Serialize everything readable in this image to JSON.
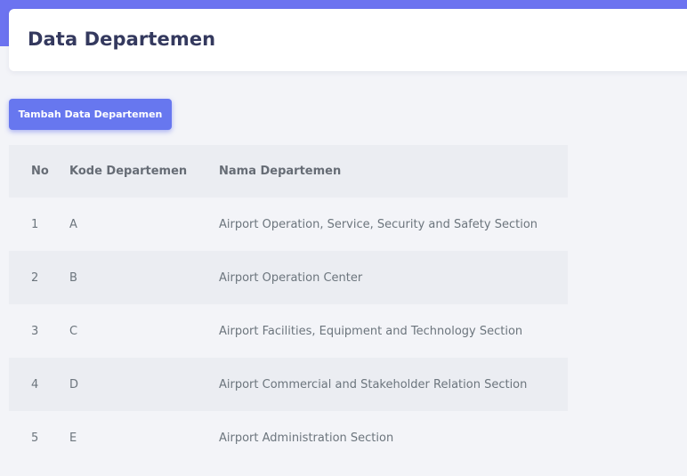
{
  "header": {
    "title": "Data Departemen"
  },
  "toolbar": {
    "add_label": "Tambah Data Departemen"
  },
  "table": {
    "columns": [
      "No",
      "Kode Departemen",
      "Nama Departemen"
    ],
    "rows": [
      {
        "no": "1",
        "kode": "A",
        "nama": "Airport Operation, Service, Security and Safety Section"
      },
      {
        "no": "2",
        "kode": "B",
        "nama": "Airport Operation Center"
      },
      {
        "no": "3",
        "kode": "C",
        "nama": "Airport Facilities, Equipment and Technology Section"
      },
      {
        "no": "4",
        "kode": "D",
        "nama": "Airport Commercial and Stakeholder Relation Section"
      },
      {
        "no": "5",
        "kode": "E",
        "nama": "Airport Administration Section"
      }
    ]
  },
  "colors": {
    "accent": "#6777ef",
    "top_band": "#6c73f0",
    "title": "#34395e",
    "stripe": "#ebedf2",
    "background": "#f3f4f8"
  }
}
